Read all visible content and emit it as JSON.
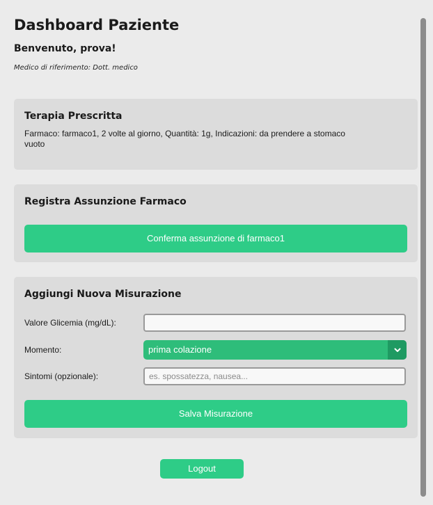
{
  "header": {
    "title": "Dashboard Paziente",
    "welcome": "Benvenuto, prova!",
    "doctor": "Medico di riferimento: Dott. medico"
  },
  "therapy": {
    "title": "Terapia Prescritta",
    "text": "Farmaco: farmaco1, 2 volte al giorno, Quantità: 1g, Indicazioni: da prendere a stomaco vuoto"
  },
  "intake": {
    "title": "Registra Assunzione Farmaco",
    "button_label": "Conferma assunzione di farmaco1"
  },
  "measurement": {
    "title": "Aggiungi Nuova Misurazione",
    "glucose_label": "Valore Glicemia (mg/dL):",
    "glucose_value": "",
    "moment_label": "Momento:",
    "moment_value": "prima colazione",
    "symptoms_label": "Sintomi (opzionale):",
    "symptoms_placeholder": "es. spossatezza, nausea...",
    "save_label": "Salva Misurazione"
  },
  "logout_label": "Logout",
  "colors": {
    "accent": "#2ecc87",
    "select": "#2ebd7a",
    "card_bg": "#dcdcdc",
    "page_bg": "#ebebeb"
  }
}
